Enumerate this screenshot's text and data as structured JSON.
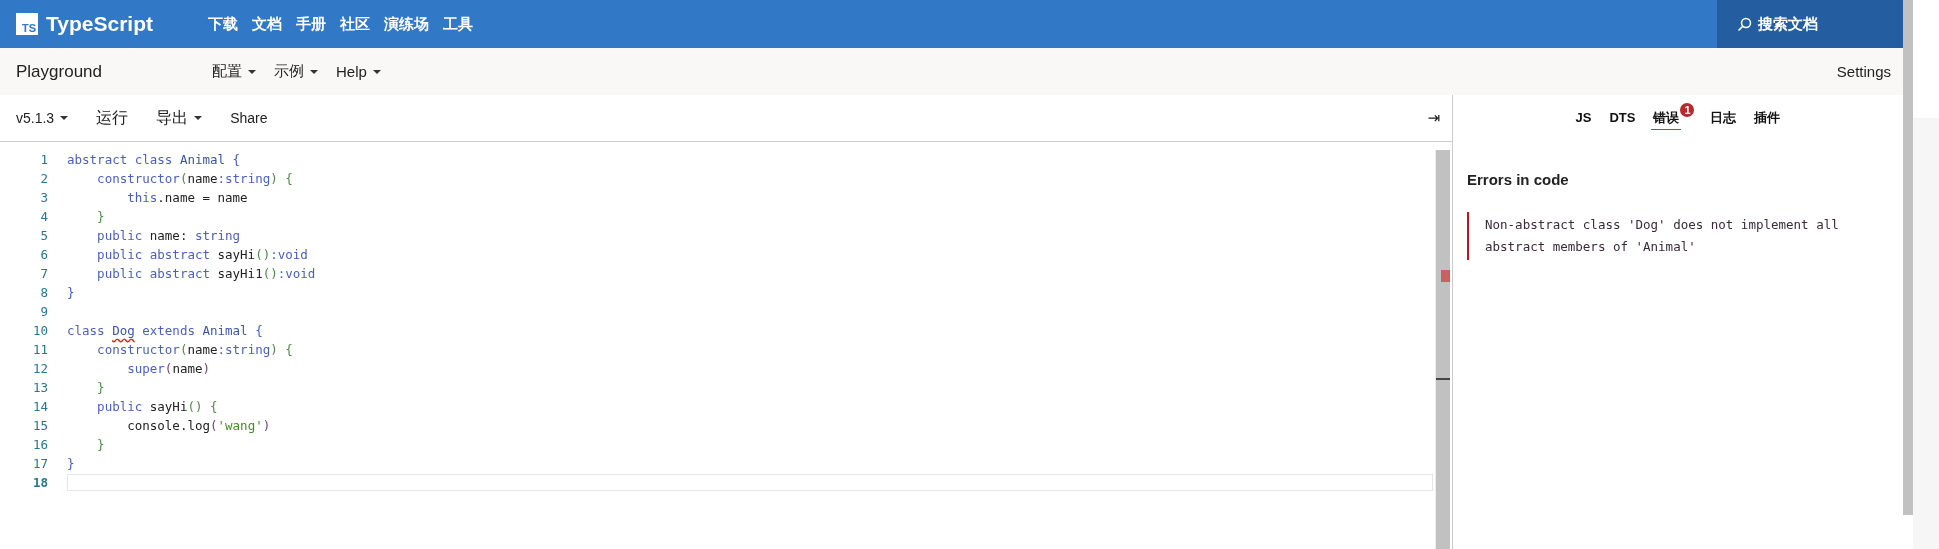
{
  "header": {
    "logo": "TS",
    "brand": "TypeScript",
    "nav": [
      "下载",
      "文档",
      "手册",
      "社区",
      "演练场",
      "工具"
    ],
    "search": "搜索文档"
  },
  "subbar": {
    "title": "Playground",
    "menus": [
      "配置",
      "示例",
      "Help"
    ],
    "settings": "Settings"
  },
  "toolbar": {
    "version": "v5.1.3",
    "run": "运行",
    "export": "导出",
    "share": "Share",
    "collapse": "⇥"
  },
  "editor": {
    "lines": [
      {
        "number": "1",
        "current": false,
        "tokens": [
          {
            "kind": "kw",
            "text": "abstract class "
          },
          {
            "kind": "type",
            "text": "Animal "
          },
          {
            "kind": "b1",
            "text": "{"
          }
        ]
      },
      {
        "number": "2",
        "current": false,
        "tokens": [
          {
            "kind": "kw",
            "text": "    constructor"
          },
          {
            "kind": "b2",
            "text": "("
          },
          {
            "kind": "id",
            "text": "name"
          },
          {
            "kind": "kw",
            "text": ":string"
          },
          {
            "kind": "b2",
            "text": ") {"
          }
        ]
      },
      {
        "number": "3",
        "current": false,
        "tokens": [
          {
            "kind": "kw",
            "text": "        this"
          },
          {
            "kind": "id",
            "text": ".name = name"
          }
        ]
      },
      {
        "number": "4",
        "current": false,
        "tokens": [
          {
            "kind": "b2",
            "text": "    }"
          }
        ]
      },
      {
        "number": "5",
        "current": false,
        "tokens": [
          {
            "kind": "kw",
            "text": "    public "
          },
          {
            "kind": "id",
            "text": "name: "
          },
          {
            "kind": "kw",
            "text": "string"
          }
        ]
      },
      {
        "number": "6",
        "current": false,
        "tokens": [
          {
            "kind": "kw",
            "text": "    public abstract "
          },
          {
            "kind": "id",
            "text": "sayHi"
          },
          {
            "kind": "b2",
            "text": "()"
          },
          {
            "kind": "kw",
            "text": ":void"
          }
        ]
      },
      {
        "number": "7",
        "current": false,
        "tokens": [
          {
            "kind": "kw",
            "text": "    public abstract "
          },
          {
            "kind": "id",
            "text": "sayHi1"
          },
          {
            "kind": "b2",
            "text": "()"
          },
          {
            "kind": "kw",
            "text": ":void"
          }
        ]
      },
      {
        "number": "8",
        "current": false,
        "tokens": [
          {
            "kind": "b1",
            "text": "}"
          }
        ]
      },
      {
        "number": "9",
        "current": false
      },
      {
        "number": "10",
        "current": false,
        "tokens": [
          {
            "kind": "kw",
            "text": "class "
          },
          {
            "kind": "error",
            "text": "Dog"
          },
          {
            "kind": "kw",
            "text": " extends "
          },
          {
            "kind": "type",
            "text": "Animal "
          },
          {
            "kind": "b1",
            "text": "{"
          }
        ]
      },
      {
        "number": "11",
        "current": false,
        "tokens": [
          {
            "kind": "kw",
            "text": "    constructor"
          },
          {
            "kind": "b2",
            "text": "("
          },
          {
            "kind": "id",
            "text": "name"
          },
          {
            "kind": "kw",
            "text": ":string"
          },
          {
            "kind": "b2",
            "text": ") {"
          }
        ]
      },
      {
        "number": "12",
        "current": false,
        "tokens": [
          {
            "kind": "kw",
            "text": "        super"
          },
          {
            "kind": "b3",
            "text": "("
          },
          {
            "kind": "id",
            "text": "name"
          },
          {
            "kind": "b3",
            "text": ")"
          }
        ]
      },
      {
        "number": "13",
        "current": false,
        "tokens": [
          {
            "kind": "b2",
            "text": "    }"
          }
        ]
      },
      {
        "number": "14",
        "current": false,
        "tokens": [
          {
            "kind": "kw",
            "text": "    public "
          },
          {
            "kind": "id",
            "text": "sayHi"
          },
          {
            "kind": "b2",
            "text": "() {"
          }
        ]
      },
      {
        "number": "15",
        "current": false,
        "tokens": [
          {
            "kind": "id",
            "text": "        console.log"
          },
          {
            "kind": "b3",
            "text": "("
          },
          {
            "kind": "str",
            "text": "'wang'"
          },
          {
            "kind": "b3",
            "text": ")"
          }
        ]
      },
      {
        "number": "16",
        "current": false,
        "tokens": [
          {
            "kind": "b2",
            "text": "    }"
          }
        ]
      },
      {
        "number": "17",
        "current": false,
        "tokens": [
          {
            "kind": "b1",
            "text": "}"
          }
        ]
      },
      {
        "number": "18",
        "current": true
      }
    ]
  },
  "output": {
    "tabs": [
      {
        "label": "JS",
        "selected": false
      },
      {
        "label": "DTS",
        "selected": false
      },
      {
        "label": "错误",
        "selected": true,
        "badge": "1"
      },
      {
        "label": "日志",
        "selected": false
      },
      {
        "label": "插件",
        "selected": false
      }
    ],
    "heading": "Errors in code",
    "errors": [
      "Non-abstract class 'Dog' does not implement all abstract members of 'Animal'"
    ]
  }
}
